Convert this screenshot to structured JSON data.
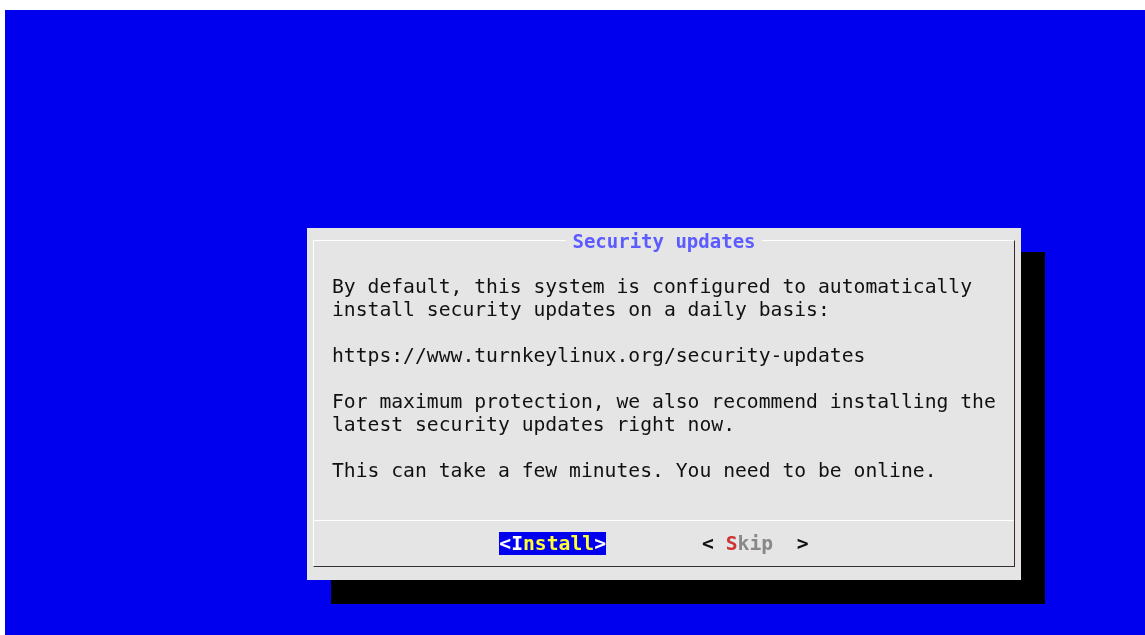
{
  "dialog": {
    "title": "Security updates",
    "paragraphs": [
      "By default, this system is configured to automatically install security updates on a daily basis:",
      "https://www.turnkeylinux.org/security-updates",
      "For maximum protection, we also recommend installing the latest security updates right now.",
      "This can take a few minutes. You need to be online."
    ],
    "buttons": [
      {
        "open": "<",
        "hotkey": "I",
        "rest": "nstall",
        "close": ">",
        "selected": true
      },
      {
        "open": "< ",
        "hotkey": "S",
        "rest": "kip",
        "close": "  >",
        "selected": false
      }
    ]
  }
}
